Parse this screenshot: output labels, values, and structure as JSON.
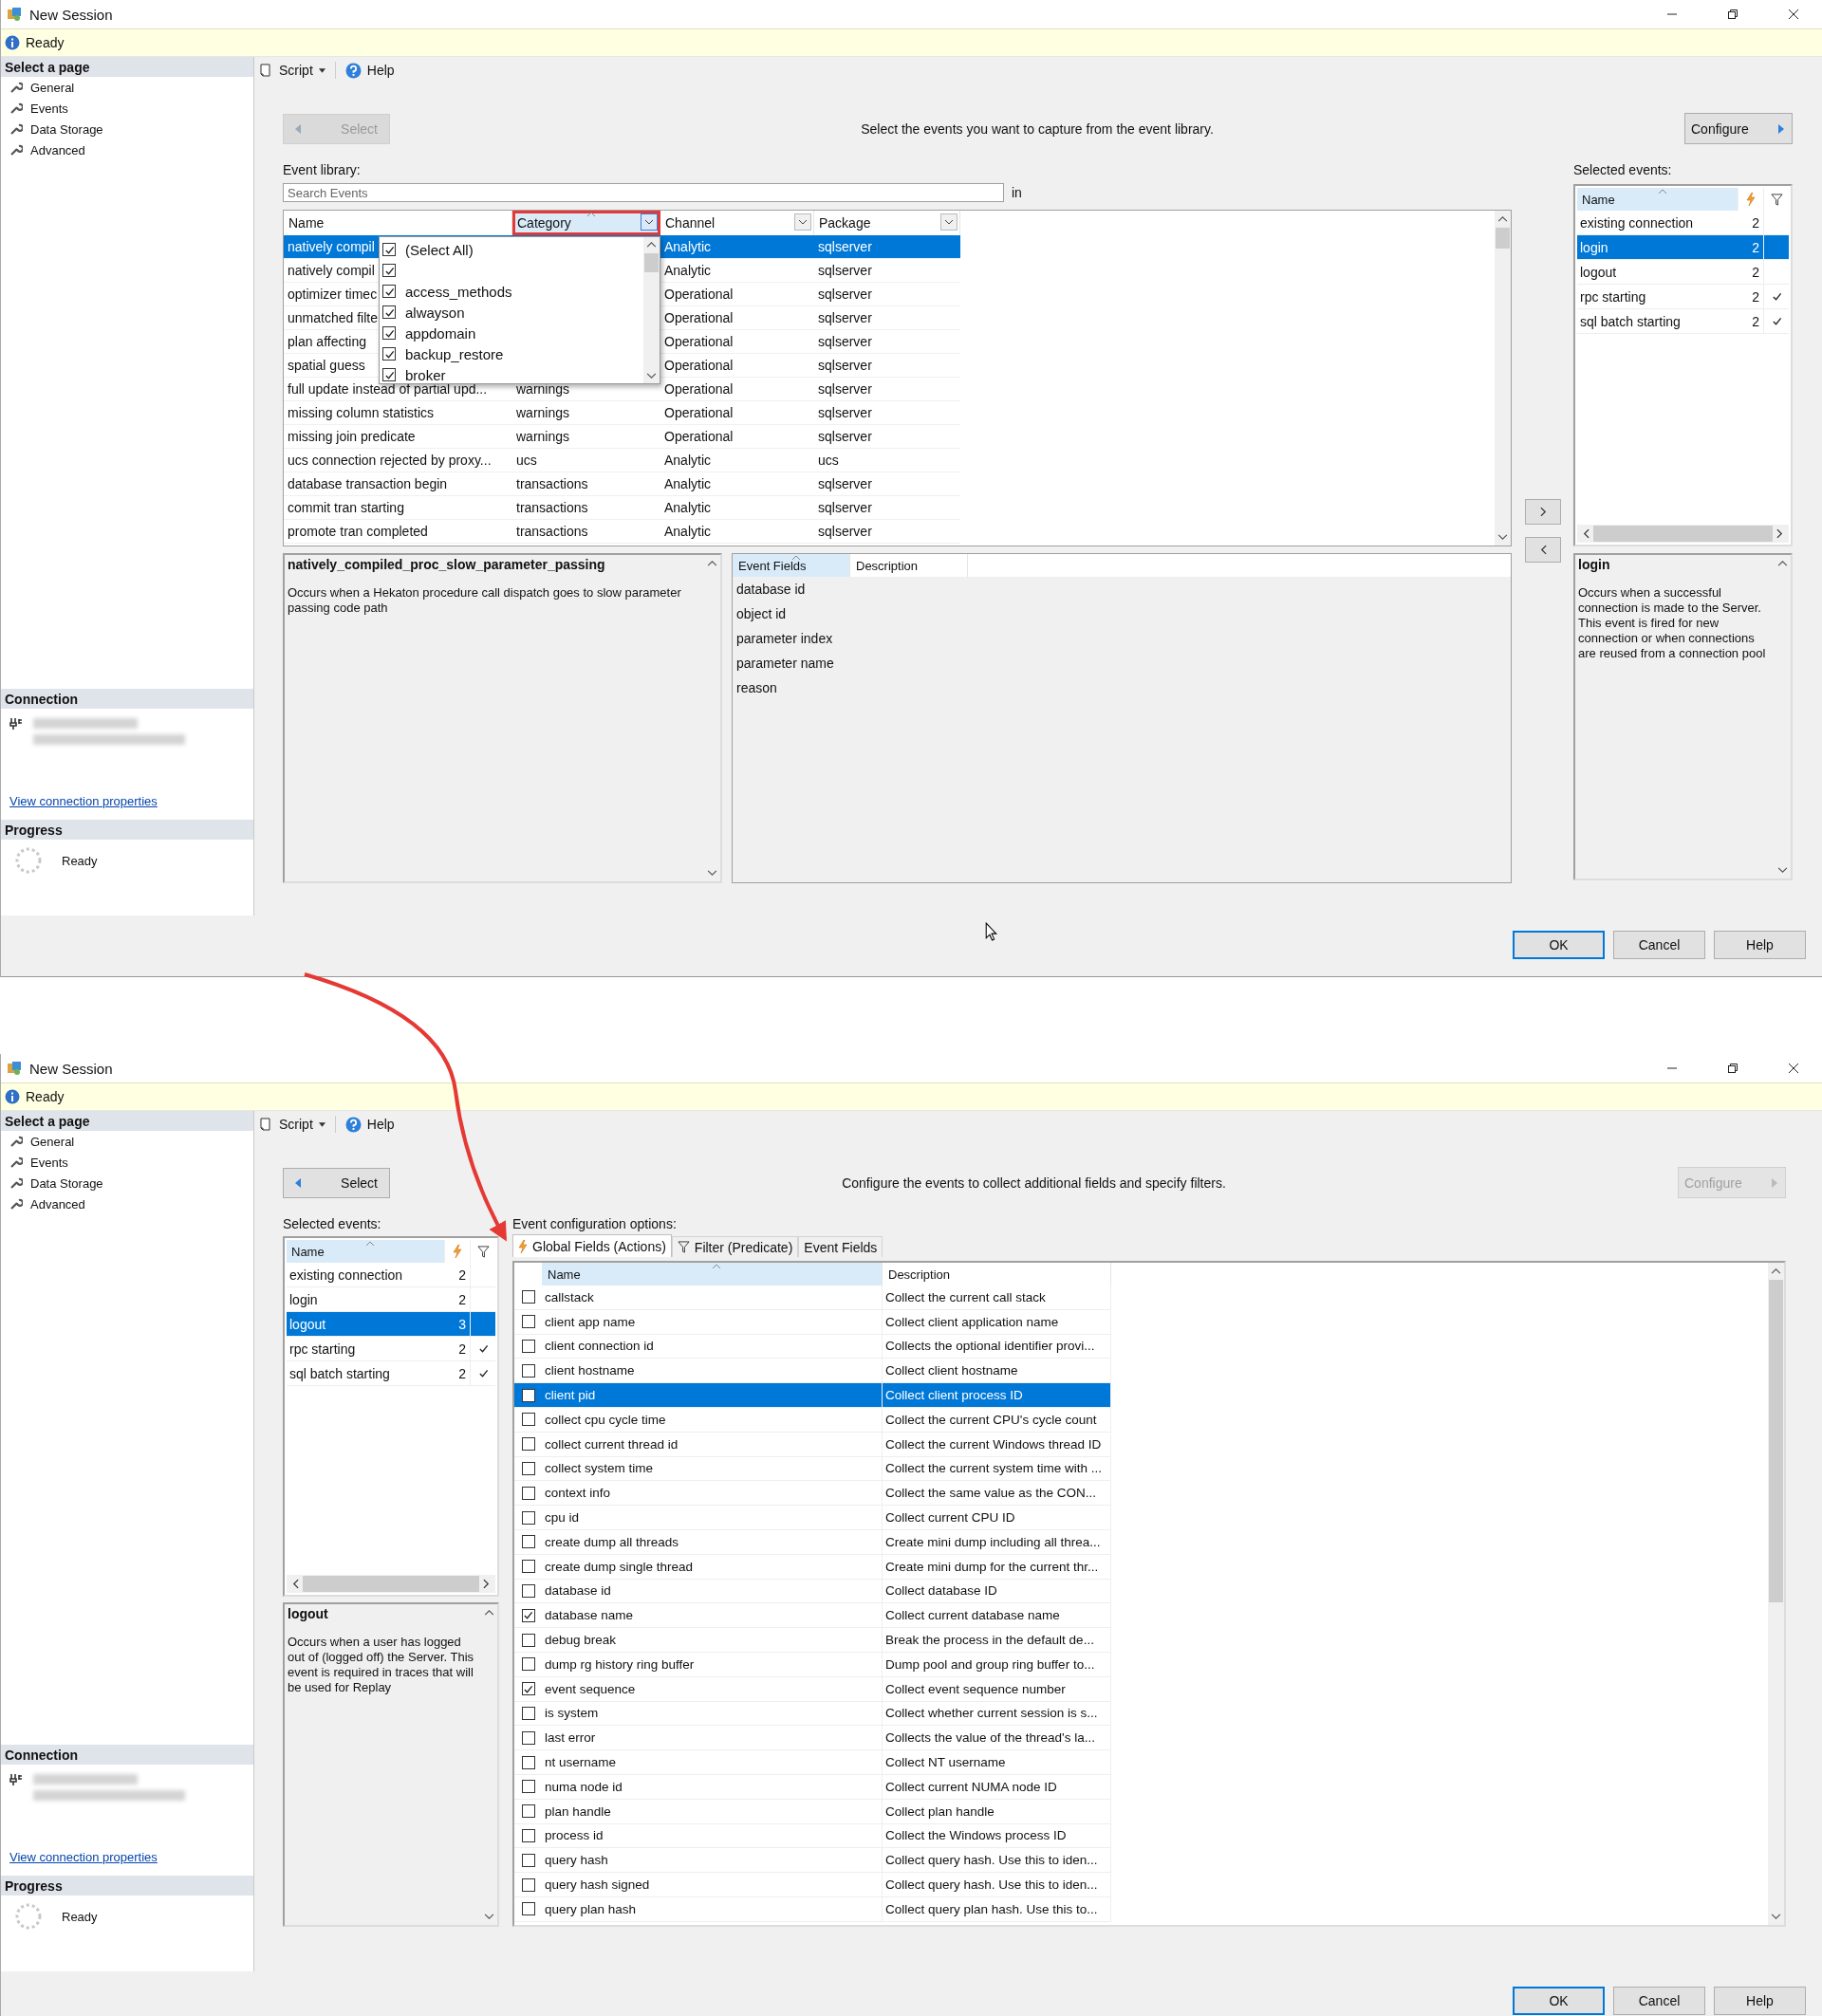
{
  "window_1": {
    "title": "New Session",
    "status": "Ready",
    "toolbar": {
      "script": "Script",
      "help": "Help"
    },
    "sidebar": {
      "heading": "Select a page",
      "pages": [
        "General",
        "Events",
        "Data Storage",
        "Advanced"
      ],
      "connection_heading": "Connection",
      "connection_link": "View connection properties",
      "progress_heading": "Progress",
      "progress_status": "Ready"
    },
    "select_button": {
      "label": "Select",
      "disabled": true
    },
    "instruction": "Select the events you want to capture from the event library.",
    "configure_button": {
      "label": "Configure",
      "disabled": false
    },
    "event_library": {
      "label": "Event library:",
      "search": {
        "placeholder": "Search Events"
      },
      "in_label": "in",
      "columns": [
        {
          "label": "Name",
          "sorted": false,
          "filter": false,
          "highlighted": false
        },
        {
          "label": "Category",
          "sorted": true,
          "filter": true,
          "highlighted": true
        },
        {
          "label": "Channel",
          "sorted": false,
          "filter": true,
          "highlighted": false
        },
        {
          "label": "Package",
          "sorted": false,
          "filter": true,
          "highlighted": false
        }
      ],
      "rows": [
        {
          "cells": [
            "natively compil",
            "",
            "Analytic",
            "sqlserver"
          ],
          "selected": true
        },
        {
          "cells": [
            "natively compil",
            "",
            "Analytic",
            "sqlserver"
          ],
          "selected": false
        },
        {
          "cells": [
            "optimizer timec",
            "",
            "Operational",
            "sqlserver"
          ],
          "selected": false
        },
        {
          "cells": [
            "unmatched filte",
            "",
            "Operational",
            "sqlserver"
          ],
          "selected": false
        },
        {
          "cells": [
            "plan affecting",
            "",
            "Operational",
            "sqlserver"
          ],
          "selected": false
        },
        {
          "cells": [
            "spatial guess",
            "",
            "Operational",
            "sqlserver"
          ],
          "selected": false
        },
        {
          "cells": [
            "full update instead of partial upd...",
            "warnings",
            "Operational",
            "sqlserver"
          ],
          "selected": false
        },
        {
          "cells": [
            "missing column statistics",
            "warnings",
            "Operational",
            "sqlserver"
          ],
          "selected": false
        },
        {
          "cells": [
            "missing join predicate",
            "warnings",
            "Operational",
            "sqlserver"
          ],
          "selected": false
        },
        {
          "cells": [
            "ucs connection rejected by proxy...",
            "ucs",
            "Analytic",
            "ucs"
          ],
          "selected": false
        },
        {
          "cells": [
            "database transaction begin",
            "transactions",
            "Analytic",
            "sqlserver"
          ],
          "selected": false
        },
        {
          "cells": [
            "commit tran starting",
            "transactions",
            "Analytic",
            "sqlserver"
          ],
          "selected": false
        },
        {
          "cells": [
            "promote tran completed",
            "transactions",
            "Analytic",
            "sqlserver"
          ],
          "selected": false
        }
      ],
      "category_filter": [
        {
          "label": "(Select All)",
          "checked": true
        },
        {
          "checked": true
        },
        {
          "label": "access_methods",
          "checked": true
        },
        {
          "label": "alwayson",
          "checked": true
        },
        {
          "label": "appdomain",
          "checked": true
        },
        {
          "label": "backup_restore",
          "checked": true
        },
        {
          "label": "broker",
          "checked": true
        }
      ]
    },
    "event_description": {
      "title": "natively_compiled_proc_slow_parameter_passing",
      "text": "Occurs when a Hekaton procedure call dispatch goes to slow parameter passing code path"
    },
    "event_fields": {
      "columns": [
        {
          "label": "Event Fields",
          "sorted": true
        },
        {
          "label": "Description",
          "sorted": false
        }
      ],
      "rows": [
        "database id",
        "object id",
        "parameter index",
        "parameter name",
        "reason"
      ]
    },
    "selected_events": {
      "label": "Selected events:",
      "columns": [
        {
          "label": "Name",
          "sorted": true
        }
      ],
      "rows": [
        {
          "name": "existing connection",
          "actions": "2",
          "filtered": false,
          "selected": false
        },
        {
          "name": "login",
          "actions": "2",
          "filtered": false,
          "selected": true
        },
        {
          "name": "logout",
          "actions": "2",
          "filtered": false,
          "selected": false
        },
        {
          "name": "rpc starting",
          "actions": "2",
          "filtered": true,
          "selected": false
        },
        {
          "name": "sql batch starting",
          "actions": "2",
          "filtered": true,
          "selected": false
        }
      ]
    },
    "selected_description": {
      "title": "login",
      "text": "Occurs when a successful connection is made to the Server. This event is fired for new connection or when connections are reused from a connection pool"
    },
    "buttons": [
      {
        "label": "OK",
        "default": true
      },
      {
        "label": "Cancel",
        "default": false
      },
      {
        "label": "Help",
        "default": false
      }
    ]
  },
  "window_2": {
    "title": "New Session",
    "status": "Ready",
    "toolbar": {
      "script": "Script",
      "help": "Help"
    },
    "sidebar": {
      "heading": "Select a page",
      "pages": [
        "General",
        "Events",
        "Data Storage",
        "Advanced"
      ],
      "connection_heading": "Connection",
      "connection_link": "View connection properties",
      "progress_heading": "Progress",
      "progress_status": "Ready"
    },
    "select_button": {
      "label": "Select",
      "disabled": false
    },
    "instruction": "Configure the events to collect additional fields and specify filters.",
    "configure_button": {
      "label": "Configure",
      "disabled": true
    },
    "selected_events": {
      "label": "Selected events:",
      "columns": [
        {
          "label": "Name",
          "sorted": true
        }
      ],
      "rows": [
        {
          "name": "existing connection",
          "actions": "2",
          "filtered": false,
          "selected": false
        },
        {
          "name": "login",
          "actions": "2",
          "filtered": false,
          "selected": false
        },
        {
          "name": "logout",
          "actions": "3",
          "filtered": false,
          "selected": true
        },
        {
          "name": "rpc starting",
          "actions": "2",
          "filtered": true,
          "selected": false
        },
        {
          "name": "sql batch starting",
          "actions": "2",
          "filtered": true,
          "selected": false
        }
      ]
    },
    "selected_description": {
      "title": "logout",
      "text": "Occurs when a user has logged out of (logged off) the Server. This event is required in traces that will be used for Replay"
    },
    "config_label": "Event configuration options:",
    "tabs": [
      {
        "label": "Global Fields (Actions)",
        "selected": true
      },
      {
        "label": "Filter (Predicate)",
        "selected": false
      },
      {
        "label": "Event Fields",
        "selected": false
      }
    ],
    "global_fields": {
      "columns": [
        {
          "label": "Name",
          "sorted": true
        },
        {
          "label": "Description",
          "sorted": false
        }
      ],
      "rows": [
        {
          "name": "callstack",
          "description": "Collect the current call stack",
          "checked": false,
          "selected": false
        },
        {
          "name": "client app name",
          "description": "Collect client application name",
          "checked": false,
          "selected": false
        },
        {
          "name": "client connection id",
          "description": "Collects the optional identifier provi...",
          "checked": false,
          "selected": false
        },
        {
          "name": "client hostname",
          "description": "Collect client hostname",
          "checked": false,
          "selected": false
        },
        {
          "name": "client pid",
          "description": "Collect client process ID",
          "checked": false,
          "selected": true
        },
        {
          "name": "collect cpu cycle time",
          "description": "Collect the current CPU's cycle count",
          "checked": false,
          "selected": false
        },
        {
          "name": "collect current thread id",
          "description": "Collect the current Windows thread ID",
          "checked": false,
          "selected": false
        },
        {
          "name": "collect system time",
          "description": "Collect the current system time with ...",
          "checked": false,
          "selected": false
        },
        {
          "name": "context info",
          "description": "Collect the same value as the CON...",
          "checked": false,
          "selected": false
        },
        {
          "name": "cpu id",
          "description": "Collect current CPU ID",
          "checked": false,
          "selected": false
        },
        {
          "name": "create dump all threads",
          "description": "Create mini dump including all threa...",
          "checked": false,
          "selected": false
        },
        {
          "name": "create dump single thread",
          "description": "Create mini dump for the current thr...",
          "checked": false,
          "selected": false
        },
        {
          "name": "database id",
          "description": "Collect database ID",
          "checked": false,
          "selected": false
        },
        {
          "name": "database name",
          "description": "Collect current database name",
          "checked": true,
          "selected": false
        },
        {
          "name": "debug break",
          "description": "Break the process in the default de...",
          "checked": false,
          "selected": false
        },
        {
          "name": "dump rg history ring buffer",
          "description": "Dump pool and group ring buffer to...",
          "checked": false,
          "selected": false
        },
        {
          "name": "event sequence",
          "description": "Collect event sequence number",
          "checked": true,
          "selected": false
        },
        {
          "name": "is system",
          "description": "Collect whether current session is s...",
          "checked": false,
          "selected": false
        },
        {
          "name": "last error",
          "description": "Collects the value of the thread's la...",
          "checked": false,
          "selected": false
        },
        {
          "name": "nt username",
          "description": "Collect NT username",
          "checked": false,
          "selected": false
        },
        {
          "name": "numa node id",
          "description": "Collect current NUMA node ID",
          "checked": false,
          "selected": false
        },
        {
          "name": "plan handle",
          "description": "Collect plan handle",
          "checked": false,
          "selected": false
        },
        {
          "name": "process id",
          "description": "Collect the Windows process ID",
          "checked": false,
          "selected": false
        },
        {
          "name": "query hash",
          "description": "Collect query hash. Use this to iden...",
          "checked": false,
          "selected": false
        },
        {
          "name": "query hash signed",
          "description": "Collect query hash. Use this to iden...",
          "checked": false,
          "selected": false
        },
        {
          "name": "query plan hash",
          "description": "Collect query plan hash. Use this to...",
          "checked": false,
          "selected": false
        }
      ]
    },
    "buttons": [
      {
        "label": "OK",
        "default": true
      },
      {
        "label": "Cancel",
        "default": false
      },
      {
        "label": "Help",
        "default": false
      }
    ]
  }
}
